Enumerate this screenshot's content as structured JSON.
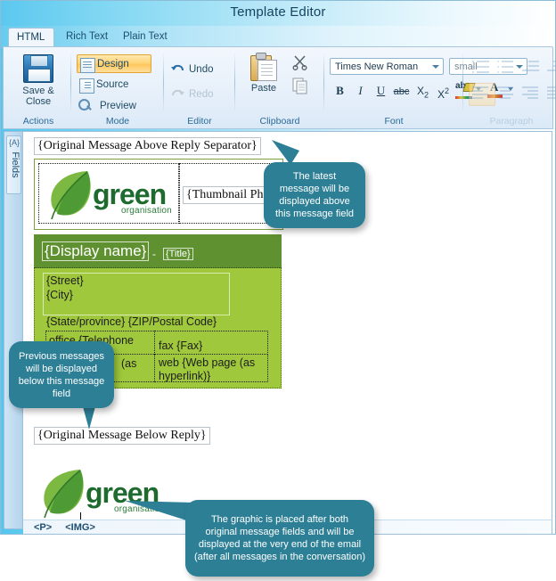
{
  "window": {
    "title": "Template Editor"
  },
  "tabs": [
    {
      "label": "HTML",
      "active": true
    },
    {
      "label": "Rich Text",
      "active": false
    },
    {
      "label": "Plain Text",
      "active": false
    }
  ],
  "ribbon": {
    "groups": [
      {
        "name": "actions",
        "label": "Actions"
      },
      {
        "name": "mode",
        "label": "Mode"
      },
      {
        "name": "editor",
        "label": "Editor"
      },
      {
        "name": "clipboard",
        "label": "Clipboard"
      },
      {
        "name": "font",
        "label": "Font"
      },
      {
        "name": "paragraph",
        "label": "Paragraph",
        "disabled": true
      }
    ],
    "actions": {
      "save_close_line1": "Save &",
      "save_close_line2": "Close",
      "save_icon": "floppy-disk-icon"
    },
    "mode": {
      "design": "Design",
      "source": "Source",
      "preview": "Preview",
      "selected": "Design"
    },
    "editor": {
      "undo": "Undo",
      "redo": "Redo",
      "redo_disabled": true
    },
    "clipboard": {
      "paste": "Paste",
      "cut_icon": "scissors-icon",
      "copy_icon": "copy-icon"
    },
    "font": {
      "family_value": "Times New Roman",
      "size_value": "small",
      "bold": "B",
      "italic": "I",
      "underline": "U",
      "strikethrough": "abc",
      "subscript": "X2",
      "superscript": "X2",
      "highlight_icon": "text-highlight-icon",
      "fontcolor_icon": "font-color-icon"
    }
  },
  "sidebar": {
    "fields_label": "Fields",
    "fields_icon": "{A}"
  },
  "editor_content": {
    "original_above": "{Original Message Above Reply Separator}",
    "thumbnail_field": "{Thumbnail Photo}",
    "logo_text": "green",
    "logo_sub": "organisation",
    "signature": {
      "display_name": "{Display name}",
      "dash": "-",
      "title": "{Title}",
      "street": "{Street}",
      "city": "{City}",
      "state_zip": "{State/province} {ZIP/Postal Code}",
      "office": "office {Telephone",
      "office_cont": "(as",
      "fax": "fax {Fax}",
      "web": "web {Web page (as",
      "web_cont": "hyperlink)}"
    },
    "original_below": "{Original Message Below Reply}"
  },
  "status_bar": {
    "tag_p": "<P>",
    "tag_img": "<IMG>"
  },
  "callouts": [
    {
      "name": "callout-latest-message",
      "text": "The latest message will be displayed above this message field"
    },
    {
      "name": "callout-previous-messages",
      "text": "Previous messages will be displayed below this message field"
    },
    {
      "name": "callout-graphic-placement",
      "text": "The graphic is placed after both original message fields and will be displayed at the very end of the email (after all messages in the conversation)"
    }
  ],
  "colors": {
    "callout": "#2d7f96",
    "green_header": "#5f9130",
    "green_body": "#9fc83c",
    "logo_green": "#1f6b2f",
    "title_bar_accent": "#5cc8ef"
  }
}
